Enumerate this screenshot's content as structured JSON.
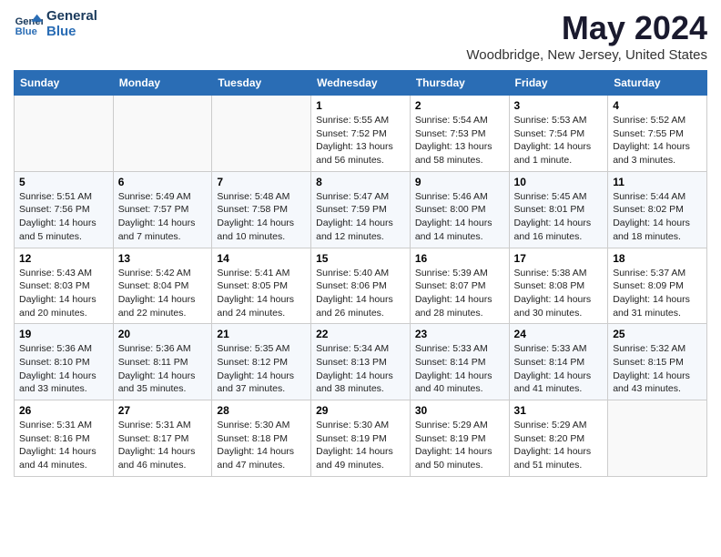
{
  "logo": {
    "line1": "General",
    "line2": "Blue"
  },
  "title": "May 2024",
  "subtitle": "Woodbridge, New Jersey, United States",
  "weekdays": [
    "Sunday",
    "Monday",
    "Tuesday",
    "Wednesday",
    "Thursday",
    "Friday",
    "Saturday"
  ],
  "weeks": [
    [
      {
        "day": "",
        "info": ""
      },
      {
        "day": "",
        "info": ""
      },
      {
        "day": "",
        "info": ""
      },
      {
        "day": "1",
        "info": "Sunrise: 5:55 AM\nSunset: 7:52 PM\nDaylight: 13 hours and 56 minutes."
      },
      {
        "day": "2",
        "info": "Sunrise: 5:54 AM\nSunset: 7:53 PM\nDaylight: 13 hours and 58 minutes."
      },
      {
        "day": "3",
        "info": "Sunrise: 5:53 AM\nSunset: 7:54 PM\nDaylight: 14 hours and 1 minute."
      },
      {
        "day": "4",
        "info": "Sunrise: 5:52 AM\nSunset: 7:55 PM\nDaylight: 14 hours and 3 minutes."
      }
    ],
    [
      {
        "day": "5",
        "info": "Sunrise: 5:51 AM\nSunset: 7:56 PM\nDaylight: 14 hours and 5 minutes."
      },
      {
        "day": "6",
        "info": "Sunrise: 5:49 AM\nSunset: 7:57 PM\nDaylight: 14 hours and 7 minutes."
      },
      {
        "day": "7",
        "info": "Sunrise: 5:48 AM\nSunset: 7:58 PM\nDaylight: 14 hours and 10 minutes."
      },
      {
        "day": "8",
        "info": "Sunrise: 5:47 AM\nSunset: 7:59 PM\nDaylight: 14 hours and 12 minutes."
      },
      {
        "day": "9",
        "info": "Sunrise: 5:46 AM\nSunset: 8:00 PM\nDaylight: 14 hours and 14 minutes."
      },
      {
        "day": "10",
        "info": "Sunrise: 5:45 AM\nSunset: 8:01 PM\nDaylight: 14 hours and 16 minutes."
      },
      {
        "day": "11",
        "info": "Sunrise: 5:44 AM\nSunset: 8:02 PM\nDaylight: 14 hours and 18 minutes."
      }
    ],
    [
      {
        "day": "12",
        "info": "Sunrise: 5:43 AM\nSunset: 8:03 PM\nDaylight: 14 hours and 20 minutes."
      },
      {
        "day": "13",
        "info": "Sunrise: 5:42 AM\nSunset: 8:04 PM\nDaylight: 14 hours and 22 minutes."
      },
      {
        "day": "14",
        "info": "Sunrise: 5:41 AM\nSunset: 8:05 PM\nDaylight: 14 hours and 24 minutes."
      },
      {
        "day": "15",
        "info": "Sunrise: 5:40 AM\nSunset: 8:06 PM\nDaylight: 14 hours and 26 minutes."
      },
      {
        "day": "16",
        "info": "Sunrise: 5:39 AM\nSunset: 8:07 PM\nDaylight: 14 hours and 28 minutes."
      },
      {
        "day": "17",
        "info": "Sunrise: 5:38 AM\nSunset: 8:08 PM\nDaylight: 14 hours and 30 minutes."
      },
      {
        "day": "18",
        "info": "Sunrise: 5:37 AM\nSunset: 8:09 PM\nDaylight: 14 hours and 31 minutes."
      }
    ],
    [
      {
        "day": "19",
        "info": "Sunrise: 5:36 AM\nSunset: 8:10 PM\nDaylight: 14 hours and 33 minutes."
      },
      {
        "day": "20",
        "info": "Sunrise: 5:36 AM\nSunset: 8:11 PM\nDaylight: 14 hours and 35 minutes."
      },
      {
        "day": "21",
        "info": "Sunrise: 5:35 AM\nSunset: 8:12 PM\nDaylight: 14 hours and 37 minutes."
      },
      {
        "day": "22",
        "info": "Sunrise: 5:34 AM\nSunset: 8:13 PM\nDaylight: 14 hours and 38 minutes."
      },
      {
        "day": "23",
        "info": "Sunrise: 5:33 AM\nSunset: 8:14 PM\nDaylight: 14 hours and 40 minutes."
      },
      {
        "day": "24",
        "info": "Sunrise: 5:33 AM\nSunset: 8:14 PM\nDaylight: 14 hours and 41 minutes."
      },
      {
        "day": "25",
        "info": "Sunrise: 5:32 AM\nSunset: 8:15 PM\nDaylight: 14 hours and 43 minutes."
      }
    ],
    [
      {
        "day": "26",
        "info": "Sunrise: 5:31 AM\nSunset: 8:16 PM\nDaylight: 14 hours and 44 minutes."
      },
      {
        "day": "27",
        "info": "Sunrise: 5:31 AM\nSunset: 8:17 PM\nDaylight: 14 hours and 46 minutes."
      },
      {
        "day": "28",
        "info": "Sunrise: 5:30 AM\nSunset: 8:18 PM\nDaylight: 14 hours and 47 minutes."
      },
      {
        "day": "29",
        "info": "Sunrise: 5:30 AM\nSunset: 8:19 PM\nDaylight: 14 hours and 49 minutes."
      },
      {
        "day": "30",
        "info": "Sunrise: 5:29 AM\nSunset: 8:19 PM\nDaylight: 14 hours and 50 minutes."
      },
      {
        "day": "31",
        "info": "Sunrise: 5:29 AM\nSunset: 8:20 PM\nDaylight: 14 hours and 51 minutes."
      },
      {
        "day": "",
        "info": ""
      }
    ]
  ]
}
